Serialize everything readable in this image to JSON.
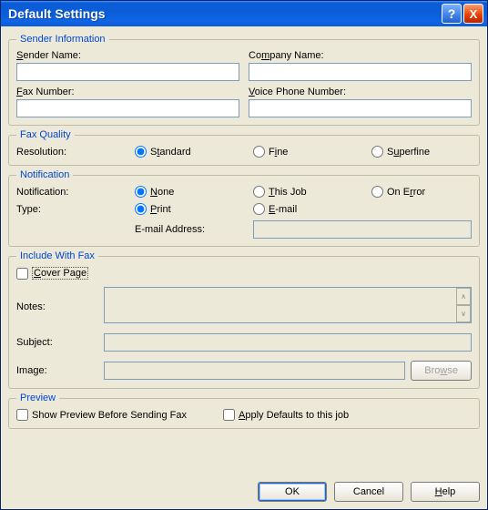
{
  "window": {
    "title": "Default Settings",
    "help": "?",
    "close": "X"
  },
  "sender": {
    "legend": "Sender Information",
    "senderName": {
      "label_pre": "",
      "label_u": "S",
      "label_post": "ender Name:",
      "value": ""
    },
    "companyName": {
      "label_pre": "Co",
      "label_u": "m",
      "label_post": "pany Name:",
      "value": ""
    },
    "faxNumber": {
      "label_pre": "",
      "label_u": "F",
      "label_post": "ax Number:",
      "value": ""
    },
    "voicePhone": {
      "label_pre": "",
      "label_u": "V",
      "label_post": "oice Phone Number:",
      "value": ""
    }
  },
  "faxQuality": {
    "legend": "Fax Quality",
    "resolutionLabel": "Resolution:",
    "options": {
      "standard": {
        "u": "",
        "pre": "S",
        "uch": "t",
        "post": "andard"
      },
      "fine": {
        "pre": "F",
        "uch": "i",
        "post": "ne"
      },
      "superfine": {
        "pre": "S",
        "uch": "u",
        "post": "perfine"
      }
    },
    "selected": "standard"
  },
  "notification": {
    "legend": "Notification",
    "notificationLabel": "Notification:",
    "typeLabel": "Type:",
    "emailLabel": "E-mail Address:",
    "options": {
      "none": {
        "pre": "",
        "uch": "N",
        "post": "one"
      },
      "thisJob": {
        "pre": "",
        "uch": "T",
        "post": "his Job"
      },
      "onError": {
        "pre": "On E",
        "uch": "r",
        "post": "ror"
      },
      "print": {
        "pre": "",
        "uch": "P",
        "post": "rint"
      },
      "email": {
        "pre": "",
        "uch": "E",
        "post": "-mail"
      }
    },
    "selectedNotify": "none",
    "selectedType": "print",
    "emailValue": ""
  },
  "include": {
    "legend": "Include With Fax",
    "coverPage": {
      "pre": "",
      "uch": "C",
      "post": "over Page"
    },
    "notesLabel": "Notes:",
    "notesValue": "",
    "subjectLabel": "Subject:",
    "subjectValue": "",
    "imageLabel": "Image:",
    "imageValue": "",
    "browse": {
      "pre": "Bro",
      "uch": "w",
      "post": "se"
    }
  },
  "preview": {
    "legend": "Preview",
    "showPreview": "Show Preview Before Sending Fax",
    "applyDefaults": {
      "pre": "",
      "uch": "A",
      "post": "pply Defaults to this job"
    }
  },
  "footer": {
    "ok": "OK",
    "cancel": "Cancel",
    "help": {
      "uch": "H",
      "post": "elp"
    }
  }
}
